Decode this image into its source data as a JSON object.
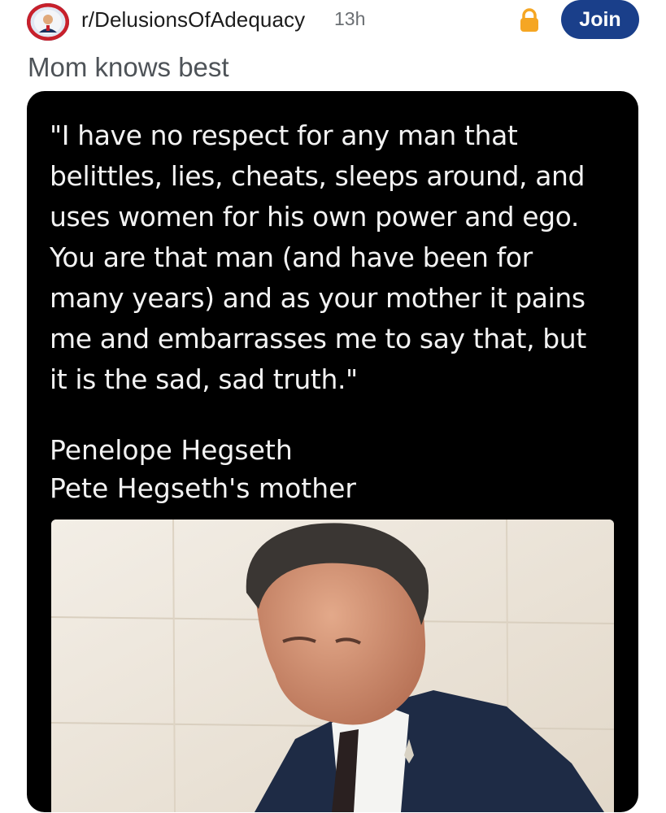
{
  "post": {
    "subreddit": "r/DelusionsOfAdequacy",
    "age": "13h",
    "join_label": "Join",
    "title": "Mom knows best"
  },
  "icons": {
    "avatar": "subreddit-avatar",
    "lock": "lock-icon"
  },
  "colors": {
    "join_button": "#1a3f8a",
    "lock": "#f5a623",
    "card_background": "#000000"
  },
  "image": {
    "quote": "\"I have no respect for any man that\nbelittles, lies, cheats, sleeps around, and\nuses women for his own power and ego.\nYou are that man (and have been for\nmany years) and as your mother it pains\nme and embarrasses me to say that, but\nit is the sad, sad truth.\"",
    "author_name": "Penelope Hegseth",
    "author_role": "Pete Hegseth's mother"
  }
}
